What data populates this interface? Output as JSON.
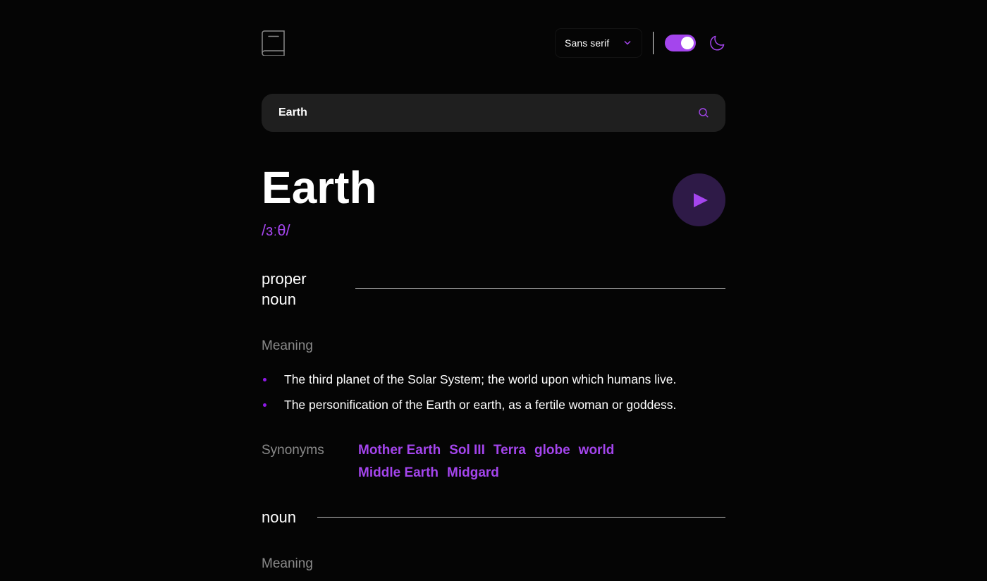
{
  "header": {
    "font_select": "Sans serif"
  },
  "search": {
    "value": "Earth"
  },
  "entry": {
    "word": "Earth",
    "phonetic": "/ɜːθ/"
  },
  "meanings": [
    {
      "part_of_speech": "proper noun",
      "meaning_label": "Meaning",
      "definitions": [
        "The third planet of the Solar System; the world upon which humans live.",
        "The personification of the Earth or earth, as a fertile woman or goddess."
      ],
      "synonyms_label": "Synonyms",
      "synonyms": [
        "Mother Earth",
        "Sol III",
        "Terra",
        "globe",
        "world",
        "Middle Earth",
        "Midgard"
      ]
    },
    {
      "part_of_speech": "noun",
      "meaning_label": "Meaning"
    }
  ],
  "colors": {
    "accent": "#a445ed",
    "background": "#050505",
    "input_bg": "#1f1f1f",
    "muted_text": "#8a8a8a"
  },
  "icons": [
    "book-logo-icon",
    "chevron-down-icon",
    "theme-toggle",
    "moon-icon",
    "search-icon",
    "play-icon"
  ]
}
